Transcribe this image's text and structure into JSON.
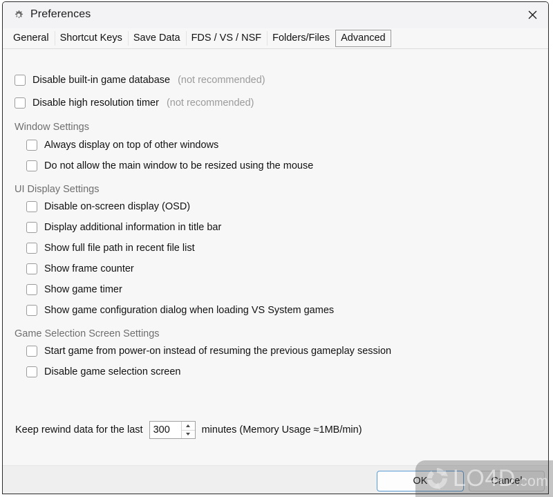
{
  "window": {
    "title": "Preferences",
    "icon": "gear-icon",
    "close_label": "✕",
    "bg_color": "#f7f7f7",
    "accent_color": "#5b9bd5"
  },
  "tabs": [
    {
      "label": "General",
      "selected": false
    },
    {
      "label": "Shortcut Keys",
      "selected": false
    },
    {
      "label": "Save Data",
      "selected": false
    },
    {
      "label": "FDS / VS / NSF",
      "selected": false
    },
    {
      "label": "Folders/Files",
      "selected": false
    },
    {
      "label": "Advanced",
      "selected": true
    }
  ],
  "top_options": [
    {
      "label": "Disable built-in game database",
      "note": "(not recommended)",
      "checked": false
    },
    {
      "label": "Disable high resolution timer",
      "note": "(not recommended)",
      "checked": false
    }
  ],
  "groups": [
    {
      "title": "Window Settings",
      "options": [
        {
          "label": "Always display on top of other windows",
          "checked": false
        },
        {
          "label": "Do not allow the main window to be resized using the mouse",
          "checked": false
        }
      ]
    },
    {
      "title": "UI Display Settings",
      "options": [
        {
          "label": "Disable on-screen display (OSD)",
          "checked": false
        },
        {
          "label": "Display additional information in title bar",
          "checked": false
        },
        {
          "label": "Show full file path in recent file list",
          "checked": false
        },
        {
          "label": "Show frame counter",
          "checked": false
        },
        {
          "label": "Show game timer",
          "checked": false
        },
        {
          "label": "Show game configuration dialog when loading VS System games",
          "checked": false
        }
      ]
    },
    {
      "title": "Game Selection Screen Settings",
      "options": [
        {
          "label": "Start game from power-on instead of resuming the previous gameplay session",
          "checked": false
        },
        {
          "label": "Disable game selection screen",
          "checked": false
        }
      ]
    }
  ],
  "rewind": {
    "prefix_label": "Keep rewind data for the last",
    "value": "300",
    "suffix_label": "minutes (Memory Usage ≈1MB/min)"
  },
  "footer": {
    "ok_label": "OK",
    "cancel_label": "Cancel"
  },
  "watermark": {
    "text_main": "LO4D",
    "text_suffix": ".com"
  }
}
